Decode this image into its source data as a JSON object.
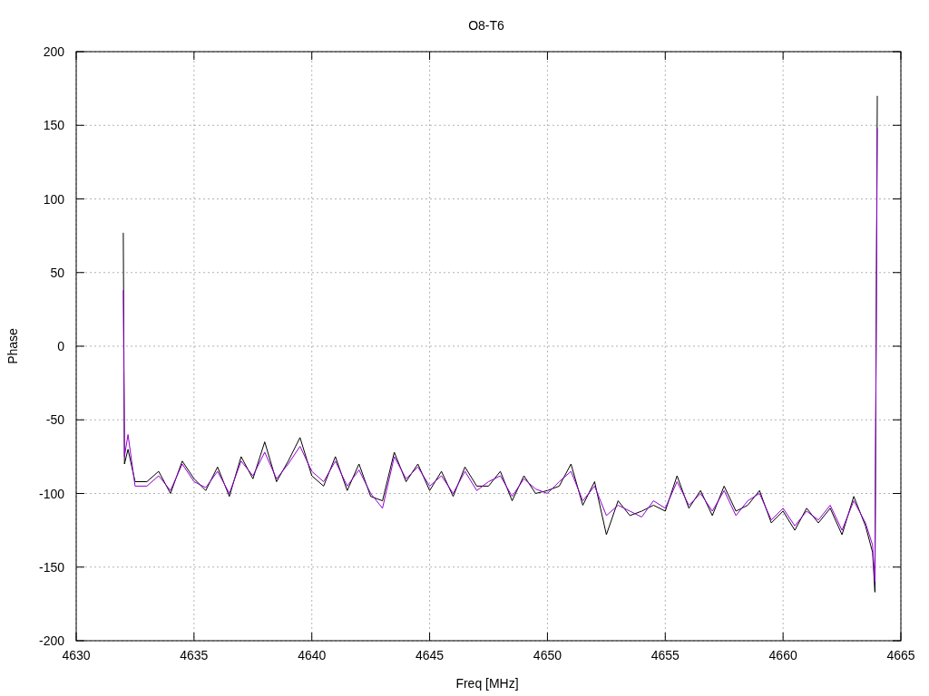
{
  "chart_data": {
    "type": "line",
    "grid": true,
    "title": "O8-T6",
    "xlabel": "Freq [MHz]",
    "ylabel": "Phase",
    "xlim": [
      4630,
      4665
    ],
    "ylim": [
      -200,
      200
    ],
    "xticks": [
      4630,
      4635,
      4640,
      4645,
      4650,
      4655,
      4660,
      4665
    ],
    "yticks": [
      -200,
      -150,
      -100,
      -50,
      0,
      50,
      100,
      150,
      200
    ],
    "x": [
      4632,
      4632.05,
      4632.2,
      4632.5,
      4633,
      4633.5,
      4634,
      4634.5,
      4635,
      4635.5,
      4636,
      4636.5,
      4637,
      4637.5,
      4638,
      4638.5,
      4639,
      4639.5,
      4640,
      4640.5,
      4641,
      4641.5,
      4642,
      4642.5,
      4643,
      4643.5,
      4644,
      4644.5,
      4645,
      4645.5,
      4646,
      4646.5,
      4647,
      4647.5,
      4648,
      4648.5,
      4649,
      4649.5,
      4650,
      4650.5,
      4651,
      4651.5,
      4652,
      4652.5,
      4653,
      4653.5,
      4654,
      4654.5,
      4655,
      4655.5,
      4656,
      4656.5,
      4657,
      4657.5,
      4658,
      4658.5,
      4659,
      4659.5,
      4660,
      4660.5,
      4661,
      4661.5,
      4662,
      4662.5,
      4663,
      4663.5,
      4663.8,
      4663.9,
      4664
    ],
    "series": [
      {
        "color": "#000000",
        "values": [
          77,
          -80,
          -70,
          -92,
          -92,
          -85,
          -100,
          -78,
          -90,
          -98,
          -82,
          -102,
          -75,
          -90,
          -65,
          -92,
          -78,
          -62,
          -88,
          -95,
          -75,
          -98,
          -80,
          -102,
          -105,
          -72,
          -92,
          -80,
          -98,
          -85,
          -102,
          -82,
          -95,
          -95,
          -85,
          -105,
          -88,
          -100,
          -98,
          -95,
          -80,
          -108,
          -92,
          -128,
          -105,
          -115,
          -112,
          -108,
          -112,
          -88,
          -110,
          -98,
          -115,
          -95,
          -112,
          -108,
          -98,
          -120,
          -112,
          -125,
          -110,
          -120,
          -110,
          -128,
          -102,
          -122,
          -140,
          -167,
          170
        ]
      },
      {
        "color": "#9400d3",
        "values": [
          38,
          -75,
          -60,
          -95,
          -95,
          -88,
          -98,
          -80,
          -92,
          -96,
          -85,
          -100,
          -78,
          -88,
          -72,
          -90,
          -80,
          -68,
          -85,
          -92,
          -78,
          -95,
          -84,
          -100,
          -110,
          -75,
          -90,
          -82,
          -95,
          -88,
          -100,
          -85,
          -98,
          -92,
          -88,
          -102,
          -90,
          -97,
          -100,
          -92,
          -85,
          -105,
          -95,
          -115,
          -108,
          -112,
          -116,
          -105,
          -110,
          -92,
          -108,
          -100,
          -112,
          -98,
          -115,
          -105,
          -100,
          -118,
          -110,
          -122,
          -112,
          -118,
          -108,
          -125,
          -105,
          -120,
          -135,
          -160,
          148
        ]
      }
    ]
  }
}
